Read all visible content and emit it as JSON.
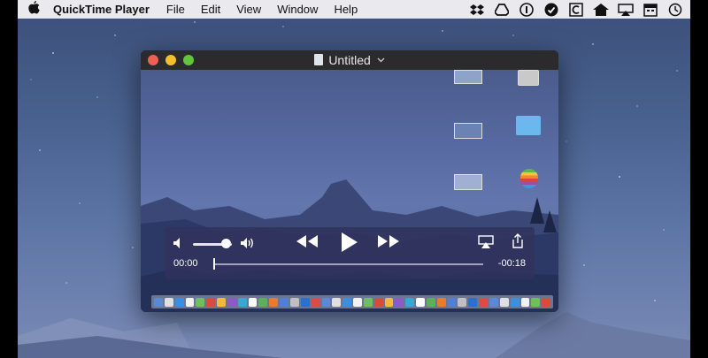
{
  "menubar": {
    "app_name": "QuickTime Player",
    "items": [
      "File",
      "Edit",
      "View",
      "Window",
      "Help"
    ],
    "status_icons": [
      "dropbox-icon",
      "drive-icon",
      "info-circle-icon",
      "check-circle-icon",
      "c-box-icon",
      "home-icon",
      "airplay-icon",
      "calendar-icon",
      "time-machine-icon"
    ]
  },
  "window": {
    "title": "Untitled"
  },
  "player": {
    "current_time": "00:00",
    "remaining_time": "-00:18",
    "volume_level": 0.85,
    "progress": 0.0
  },
  "colors": {
    "close": "#ed5f57",
    "minimize": "#f5be2f",
    "maximize": "#5fc73c",
    "controls_bg": "#30325c"
  }
}
